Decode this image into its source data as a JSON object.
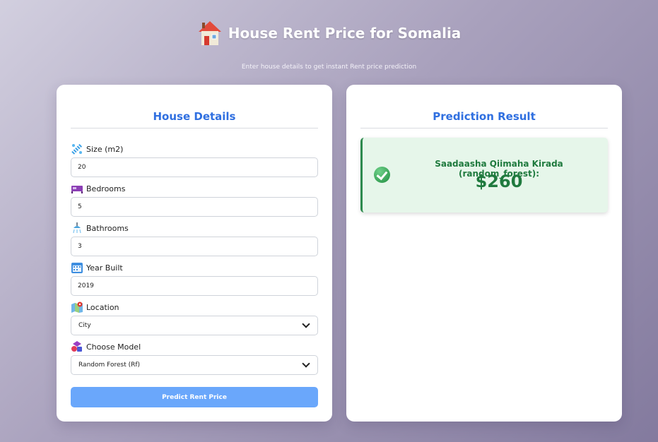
{
  "header": {
    "title": "House Rent Price for Somalia",
    "subtitle": "Enter house details to get instant Rent price prediction"
  },
  "form": {
    "title": "House Details",
    "fields": [
      {
        "label": "Size (m2)",
        "value": "20",
        "icon": "ruler-icon"
      },
      {
        "label": "Bedrooms",
        "value": "5",
        "icon": "bed-icon"
      },
      {
        "label": "Bathrooms",
        "value": "3",
        "icon": "shower-icon"
      },
      {
        "label": "Year Built",
        "value": "2019",
        "icon": "calendar-icon"
      }
    ],
    "location": {
      "label": "Location",
      "selected": "City",
      "icon": "map-icon"
    },
    "model": {
      "label": "Choose Model",
      "selected": "Random Forest (Rf)",
      "icon": "shapes-icon"
    },
    "submit_label": "Predict Rent Price"
  },
  "result": {
    "title": "Prediction Result",
    "label": "Saadaasha Qiimaha Kirada (random_forest):",
    "value": "$260"
  },
  "colors": {
    "accent": "#2f6fe0",
    "button": "#6aa7fb",
    "success": "#1f7a3e",
    "success_bg": "#e6f6ea"
  }
}
